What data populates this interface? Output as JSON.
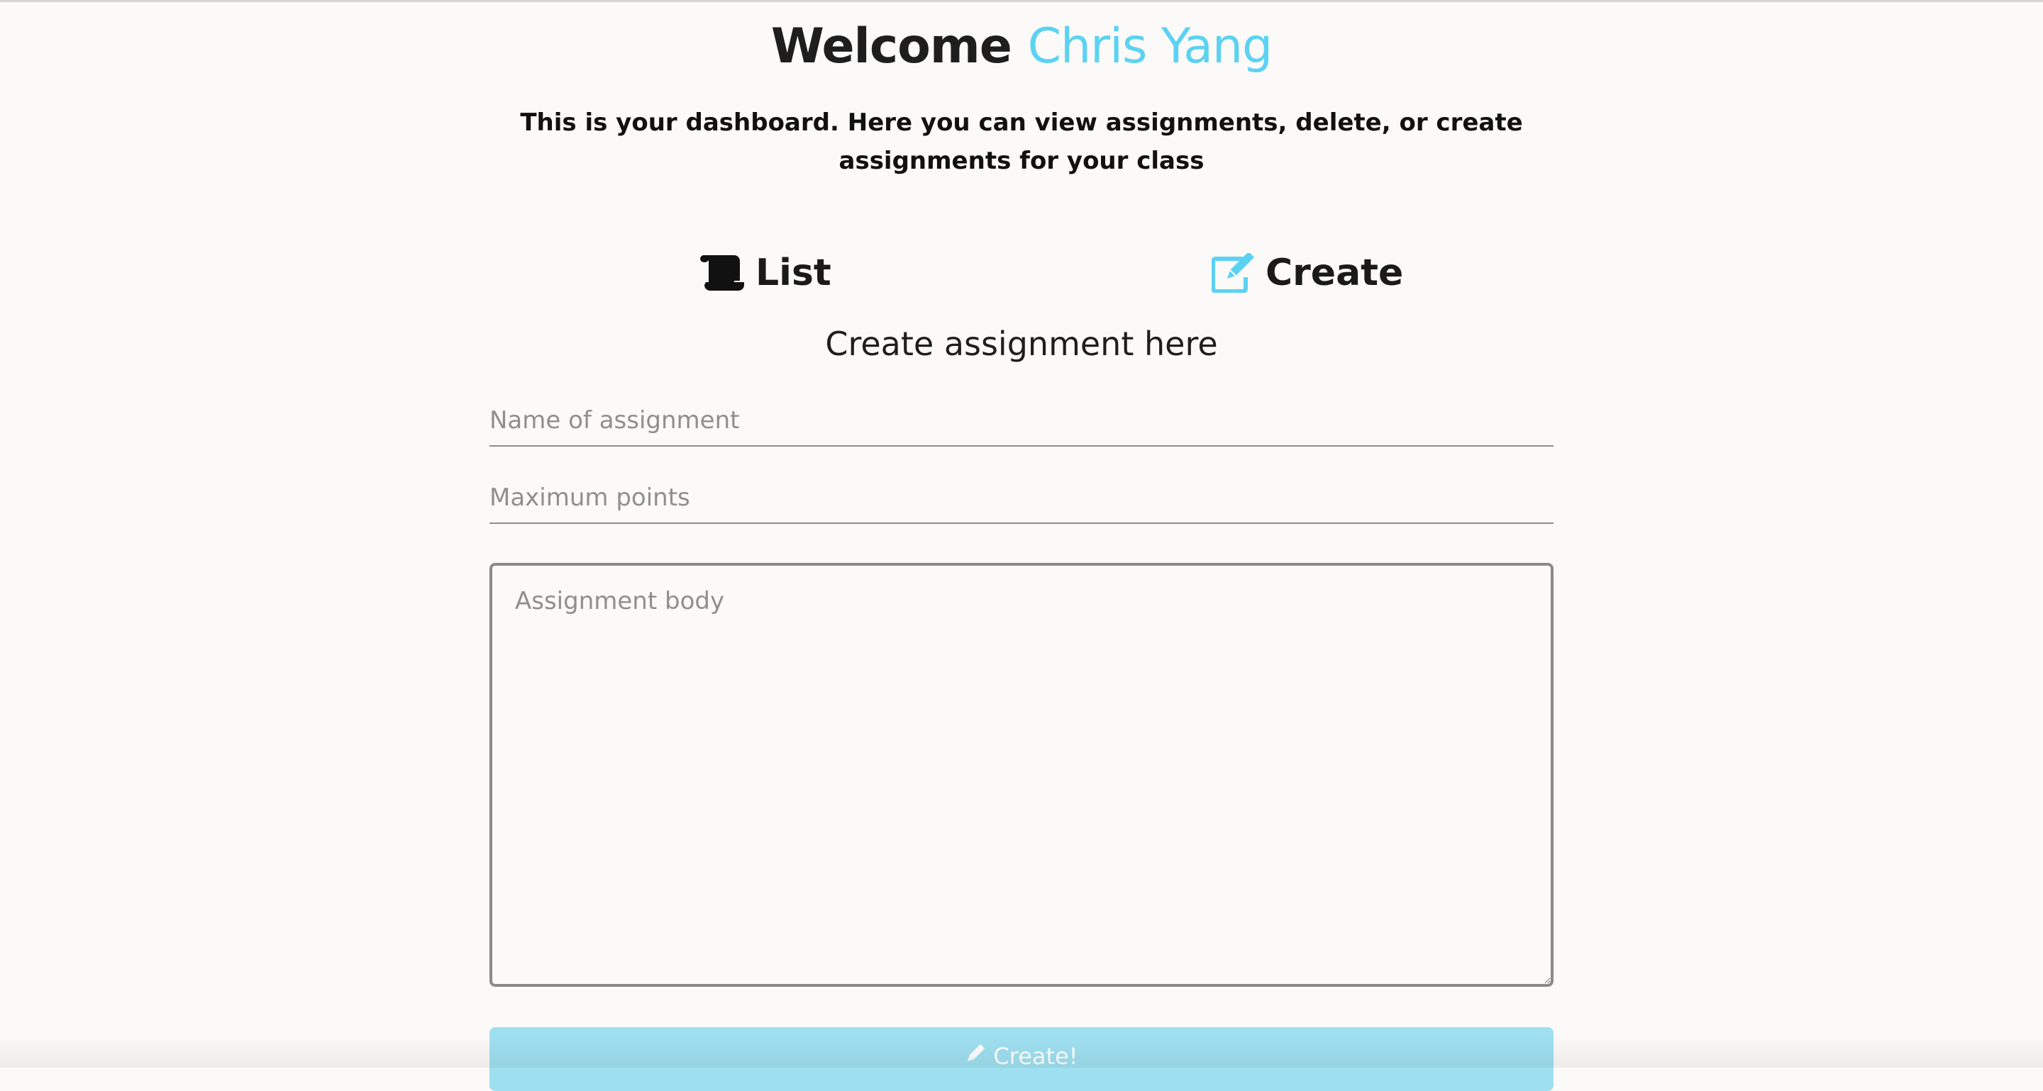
{
  "header": {
    "welcome_prefix": "Welcome",
    "user_name": "Chris Yang",
    "intro_text": "This is your dashboard. Here you can view assignments, delete, or create assignments for your class"
  },
  "tabs": [
    {
      "label": "List",
      "icon": "scroll-icon"
    },
    {
      "label": "Create",
      "icon": "edit-icon"
    }
  ],
  "form": {
    "title": "Create assignment here",
    "name_placeholder": "Name of assignment",
    "points_placeholder": "Maximum points",
    "body_placeholder": "Assignment body",
    "submit_label": "Create!",
    "submit_icon": "pencil-icon"
  },
  "colors": {
    "accent": "#5cd2f2",
    "button": "#9fe0f0",
    "background": "#fbfaf8"
  }
}
